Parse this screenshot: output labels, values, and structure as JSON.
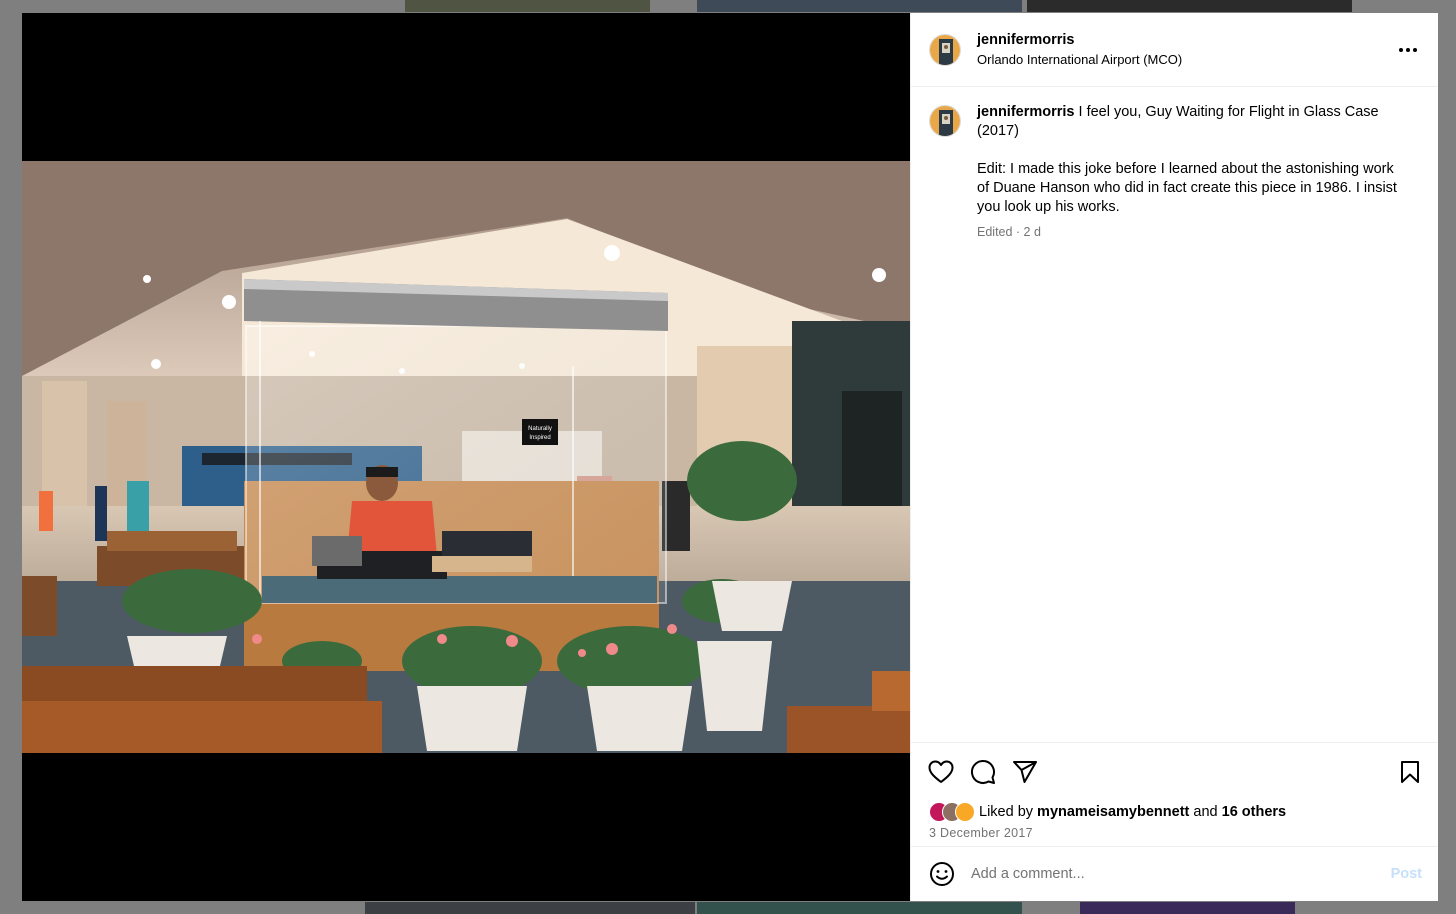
{
  "post": {
    "username": "jennifermorris",
    "location": "Orlando International Airport (MCO)",
    "more_icon": "more-horizontal-icon"
  },
  "caption": {
    "username": "jennifermorris",
    "text": "I feel you, Guy Waiting for Flight in Glass Case (2017)",
    "edit_text": "Edit: I made this joke before I learned about the astonishing work of Duane Hanson who did in fact create this piece in 1986. I insist you look up his works.",
    "meta": "Edited · 2 d"
  },
  "photo": {
    "sign_text_1": "Naturally",
    "sign_text_2": "Inspired"
  },
  "actions": {
    "icons": [
      "heart-icon",
      "comment-icon",
      "share-icon",
      "bookmark-icon"
    ]
  },
  "likes": {
    "prefix": "Liked by",
    "user": "mynameisamybennett",
    "joiner": "and",
    "others": "16 others",
    "avatar_colors": [
      "#c2185b",
      "#8d6e63",
      "#f9a825"
    ]
  },
  "date": "3 December 2017",
  "comment": {
    "placeholder": "Add a comment...",
    "post_label": "Post",
    "emoji_icon": "emoji-icon"
  },
  "colors": {
    "overlay": "#7f7f7f",
    "link_disabled": "#c6e0fb",
    "secondary_text": "#737373"
  }
}
